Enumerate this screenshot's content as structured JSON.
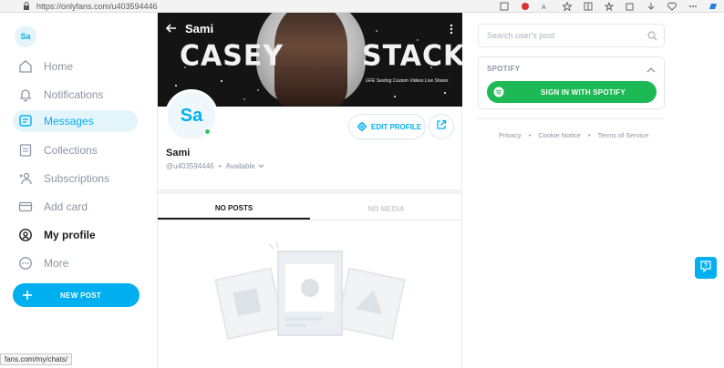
{
  "browser": {
    "url": "https://onlyfans.com/u403594446",
    "status_url": "fans.com/my/chats/"
  },
  "sidebar": {
    "avatar_initials": "Sa",
    "items": [
      {
        "label": "Home",
        "icon": "home-icon"
      },
      {
        "label": "Notifications",
        "icon": "bell-icon"
      },
      {
        "label": "Messages",
        "icon": "message-icon",
        "active": true
      },
      {
        "label": "Collections",
        "icon": "bookmark-icon"
      },
      {
        "label": "Subscriptions",
        "icon": "user-star-icon"
      },
      {
        "label": "Add card",
        "icon": "card-icon"
      },
      {
        "label": "My profile",
        "icon": "profile-icon"
      },
      {
        "label": "More",
        "icon": "more-icon"
      }
    ],
    "new_post_label": "NEW POST"
  },
  "profile": {
    "banner_title_left": "CASEY",
    "banner_title_right": "STACKS",
    "banner_subtitle": "GFE Sexting Custom Videos Live Shows",
    "header_name": "Sami",
    "avatar_initials": "Sa",
    "name": "Sami",
    "handle": "@u403594446",
    "separator": "•",
    "availability": "Available",
    "edit_label": "EDIT PROFILE",
    "tabs": [
      {
        "label": "NO POSTS",
        "active": true
      },
      {
        "label": "NO MEDIA",
        "active": false
      }
    ]
  },
  "right": {
    "search_placeholder": "Search user's post",
    "spotify_title": "SPOTIFY",
    "spotify_button": "SIGN IN WITH SPOTIFY",
    "footer": [
      "Privacy",
      "Cookie Notice",
      "Terms of Service"
    ],
    "footer_sep": "•"
  },
  "colors": {
    "accent": "#00aff0",
    "spotify": "#1db954",
    "online": "#2ec866",
    "muted": "#8a96a3"
  }
}
